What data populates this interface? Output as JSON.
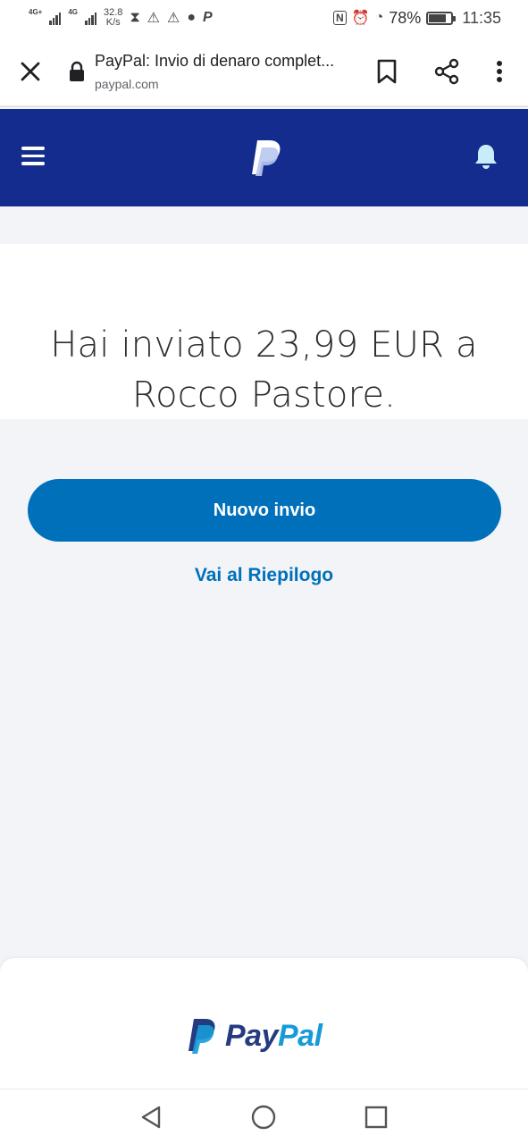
{
  "status_bar": {
    "network1": "4G+",
    "network2": "4G",
    "speed_value": "32.8",
    "speed_unit": "K/s",
    "battery": "78%",
    "battery_level": 0.78,
    "time": "11:35"
  },
  "browser": {
    "page_title": "PayPal: Invio di denaro complet...",
    "url": "paypal.com"
  },
  "main": {
    "message": "Hai inviato 23,99 EUR a Rocco Pastore.",
    "primary_button": "Nuovo invio",
    "secondary_link": "Vai al Riepilogo"
  },
  "footer": {
    "logo_pay": "Pay",
    "logo_pal": "Pal"
  },
  "colors": {
    "header_bg": "#142c8e",
    "primary_blue": "#0070ba",
    "page_bg": "#f2f4f8",
    "logo_dark": "#253b80",
    "logo_light": "#179bd7"
  },
  "icons": [
    "close-icon",
    "lock-icon",
    "bookmark-icon",
    "share-icon",
    "more-vert-icon",
    "hamburger-icon",
    "paypal-logo-mark",
    "bell-icon",
    "back-icon",
    "home-icon",
    "recents-icon"
  ]
}
